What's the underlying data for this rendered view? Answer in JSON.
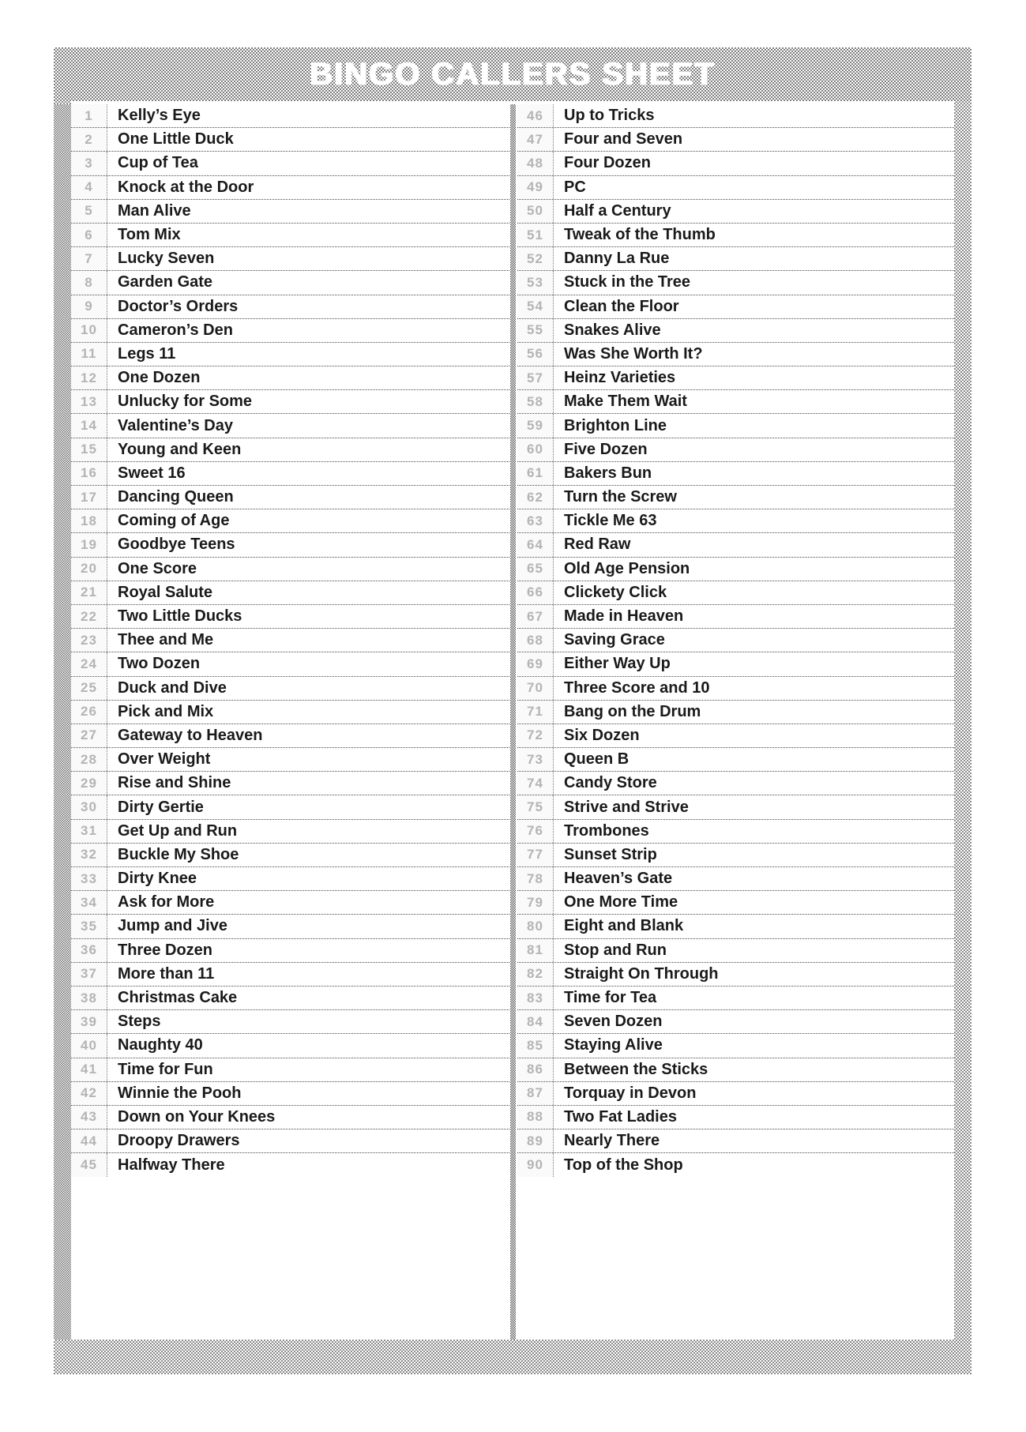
{
  "document": {
    "title": "BINGO CALLERS SHEET",
    "colors": {
      "border_dither": "#8a8a8a",
      "header_dither": "#7d7d7d",
      "title_text": "#ffffff",
      "entry_text": "#1a1a1a",
      "number_text": "#b4b4b4",
      "row_rule": "#4a4a4a"
    }
  },
  "columns": [
    {
      "id": "left-column",
      "rows": [
        {
          "number": "1",
          "name": "Kelly’s Eye"
        },
        {
          "number": "2",
          "name": "One Little Duck"
        },
        {
          "number": "3",
          "name": "Cup of Tea"
        },
        {
          "number": "4",
          "name": "Knock at the Door"
        },
        {
          "number": "5",
          "name": "Man Alive"
        },
        {
          "number": "6",
          "name": "Tom Mix"
        },
        {
          "number": "7",
          "name": "Lucky Seven"
        },
        {
          "number": "8",
          "name": "Garden Gate"
        },
        {
          "number": "9",
          "name": "Doctor’s Orders"
        },
        {
          "number": "10",
          "name": "Cameron’s Den"
        },
        {
          "number": "11",
          "name": "Legs 11"
        },
        {
          "number": "12",
          "name": "One Dozen"
        },
        {
          "number": "13",
          "name": "Unlucky for Some"
        },
        {
          "number": "14",
          "name": "Valentine’s Day"
        },
        {
          "number": "15",
          "name": "Young and Keen"
        },
        {
          "number": "16",
          "name": "Sweet 16"
        },
        {
          "number": "17",
          "name": "Dancing Queen"
        },
        {
          "number": "18",
          "name": "Coming of Age"
        },
        {
          "number": "19",
          "name": "Goodbye Teens"
        },
        {
          "number": "20",
          "name": "One Score"
        },
        {
          "number": "21",
          "name": "Royal Salute"
        },
        {
          "number": "22",
          "name": "Two Little Ducks"
        },
        {
          "number": "23",
          "name": "Thee and Me"
        },
        {
          "number": "24",
          "name": "Two Dozen"
        },
        {
          "number": "25",
          "name": "Duck and Dive"
        },
        {
          "number": "26",
          "name": "Pick and Mix"
        },
        {
          "number": "27",
          "name": "Gateway to Heaven"
        },
        {
          "number": "28",
          "name": "Over Weight"
        },
        {
          "number": "29",
          "name": "Rise and Shine"
        },
        {
          "number": "30",
          "name": "Dirty Gertie"
        },
        {
          "number": "31",
          "name": "Get Up and Run"
        },
        {
          "number": "32",
          "name": "Buckle My Shoe"
        },
        {
          "number": "33",
          "name": "Dirty Knee"
        },
        {
          "number": "34",
          "name": "Ask for More"
        },
        {
          "number": "35",
          "name": "Jump and Jive"
        },
        {
          "number": "36",
          "name": "Three Dozen"
        },
        {
          "number": "37",
          "name": "More than 11"
        },
        {
          "number": "38",
          "name": "Christmas Cake"
        },
        {
          "number": "39",
          "name": "Steps"
        },
        {
          "number": "40",
          "name": "Naughty 40"
        },
        {
          "number": "41",
          "name": "Time for Fun"
        },
        {
          "number": "42",
          "name": "Winnie the Pooh"
        },
        {
          "number": "43",
          "name": "Down on Your Knees"
        },
        {
          "number": "44",
          "name": "Droopy Drawers"
        },
        {
          "number": "45",
          "name": "Halfway There"
        }
      ]
    },
    {
      "id": "right-column",
      "rows": [
        {
          "number": "46",
          "name": "Up to Tricks"
        },
        {
          "number": "47",
          "name": "Four and Seven"
        },
        {
          "number": "48",
          "name": "Four Dozen"
        },
        {
          "number": "49",
          "name": "PC"
        },
        {
          "number": "50",
          "name": "Half a Century"
        },
        {
          "number": "51",
          "name": "Tweak of the Thumb"
        },
        {
          "number": "52",
          "name": "Danny La Rue"
        },
        {
          "number": "53",
          "name": "Stuck in the Tree"
        },
        {
          "number": "54",
          "name": "Clean the Floor"
        },
        {
          "number": "55",
          "name": "Snakes Alive"
        },
        {
          "number": "56",
          "name": "Was She Worth It?"
        },
        {
          "number": "57",
          "name": "Heinz Varieties"
        },
        {
          "number": "58",
          "name": "Make Them Wait"
        },
        {
          "number": "59",
          "name": "Brighton Line"
        },
        {
          "number": "60",
          "name": "Five Dozen"
        },
        {
          "number": "61",
          "name": "Bakers Bun"
        },
        {
          "number": "62",
          "name": "Turn the Screw"
        },
        {
          "number": "63",
          "name": "Tickle Me 63"
        },
        {
          "number": "64",
          "name": "Red Raw"
        },
        {
          "number": "65",
          "name": "Old Age Pension"
        },
        {
          "number": "66",
          "name": "Clickety Click"
        },
        {
          "number": "67",
          "name": "Made in Heaven"
        },
        {
          "number": "68",
          "name": "Saving Grace"
        },
        {
          "number": "69",
          "name": "Either Way Up"
        },
        {
          "number": "70",
          "name": "Three Score and 10"
        },
        {
          "number": "71",
          "name": "Bang on the Drum"
        },
        {
          "number": "72",
          "name": "Six Dozen"
        },
        {
          "number": "73",
          "name": "Queen B"
        },
        {
          "number": "74",
          "name": "Candy Store"
        },
        {
          "number": "75",
          "name": "Strive and Strive"
        },
        {
          "number": "76",
          "name": "Trombones"
        },
        {
          "number": "77",
          "name": "Sunset Strip"
        },
        {
          "number": "78",
          "name": "Heaven’s Gate"
        },
        {
          "number": "79",
          "name": "One More Time"
        },
        {
          "number": "80",
          "name": "Eight and Blank"
        },
        {
          "number": "81",
          "name": "Stop and Run"
        },
        {
          "number": "82",
          "name": "Straight On Through"
        },
        {
          "number": "83",
          "name": "Time for Tea"
        },
        {
          "number": "84",
          "name": "Seven Dozen"
        },
        {
          "number": "85",
          "name": "Staying Alive"
        },
        {
          "number": "86",
          "name": "Between the Sticks"
        },
        {
          "number": "87",
          "name": "Torquay in Devon"
        },
        {
          "number": "88",
          "name": "Two Fat Ladies"
        },
        {
          "number": "89",
          "name": "Nearly There"
        },
        {
          "number": "90",
          "name": "Top of the Shop"
        }
      ]
    }
  ]
}
